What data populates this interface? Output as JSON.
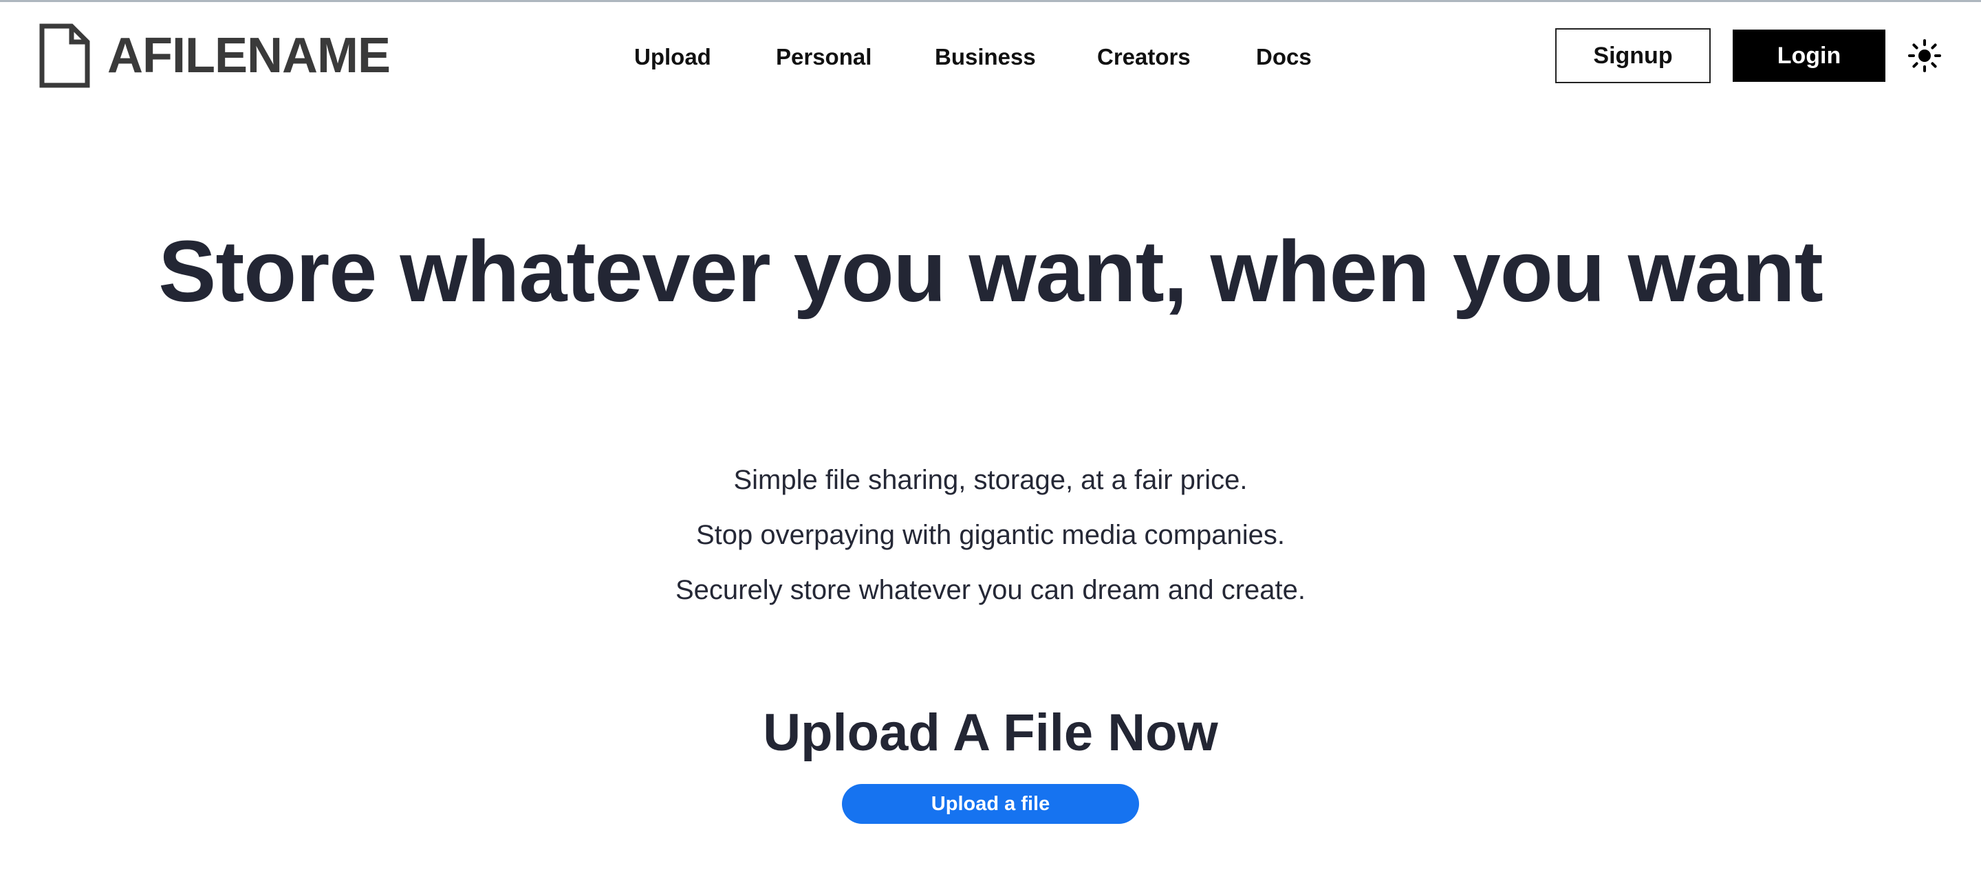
{
  "brand": {
    "name": "AFILENAME",
    "icon": "file-icon"
  },
  "nav": {
    "items": [
      {
        "label": "Upload"
      },
      {
        "label": "Personal"
      },
      {
        "label": "Business"
      },
      {
        "label": "Creators"
      },
      {
        "label": "Docs"
      }
    ]
  },
  "auth": {
    "signup_label": "Signup",
    "login_label": "Login"
  },
  "theme_toggle": {
    "icon": "sun-icon"
  },
  "hero": {
    "title": "Store whatever you want, when you want",
    "taglines": [
      "Simple file sharing, storage, at a fair price.",
      "Stop overpaying with gigantic media companies.",
      "Securely store whatever you can dream and create."
    ]
  },
  "upload": {
    "heading": "Upload A File Now",
    "button_label": "Upload a file"
  },
  "colors": {
    "primary_button": "#1673f0",
    "login_button": "#000000",
    "text_dark": "#232634"
  }
}
